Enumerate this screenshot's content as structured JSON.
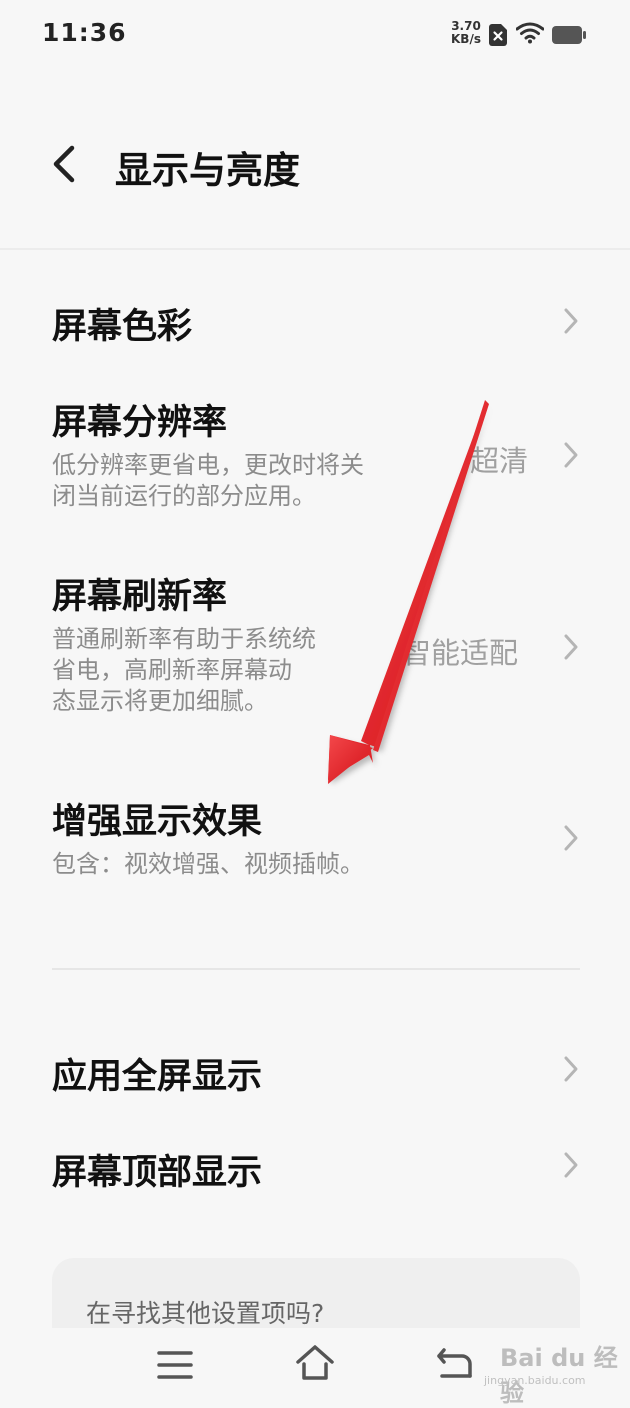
{
  "status_bar": {
    "time": "11:36",
    "net_speed_value": "3.70",
    "net_speed_unit": "KB/s",
    "icons": [
      "sim-x-icon",
      "wifi-icon",
      "battery-icon"
    ]
  },
  "header": {
    "title": "显示与亮度",
    "back_icon": "chevron-left-icon"
  },
  "items": [
    {
      "title": "屏幕色彩"
    },
    {
      "title": "屏幕分辨率",
      "sub": [
        "低分辨率更省电，更改时将关",
        "闭当前运行的部分应用。"
      ],
      "value": "超清"
    },
    {
      "title": "屏幕刷新率",
      "sub": [
        "普通刷新率有助于系统统",
        "省电，高刷新率屏幕动",
        "态显示将更加细腻。"
      ],
      "value": "智能适配"
    },
    {
      "title": "增强显示效果",
      "sub": [
        "包含：视效增强、视频插帧。"
      ]
    },
    {
      "title": "应用全屏显示"
    },
    {
      "title": "屏幕顶部显示"
    }
  ],
  "suggest": {
    "text": "在寻找其他设置项吗?"
  },
  "nav_bar": {
    "icons": [
      "menu-icon",
      "home-icon",
      "back-icon"
    ]
  },
  "watermark": {
    "brand": "Bai du 经验",
    "site": "jingyan.baidu.com"
  },
  "colors": {
    "background": "#f7f7f7",
    "arrow": "#e3151b",
    "secondary_text": "#8c8c8c"
  }
}
